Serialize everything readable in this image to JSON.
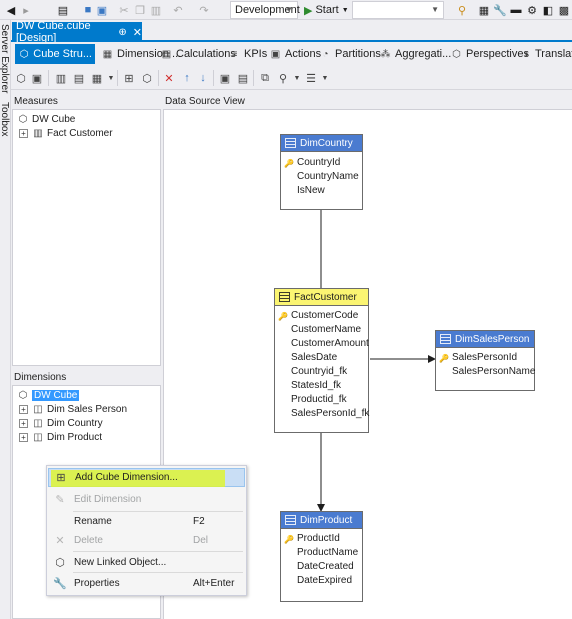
{
  "main_toolbar": {
    "solution_config": "Development",
    "start_label": "Start"
  },
  "side_strip": {
    "server_explorer": "Server Explorer",
    "toolbox": "Toolbox"
  },
  "document_tab": {
    "title": "DW Cube.cube [Design]",
    "pin": "⊕",
    "close": "✕"
  },
  "designer_tabs": [
    {
      "label": "Cube Stru...",
      "icon": "cube-icon"
    },
    {
      "label": "Dimension ...",
      "icon": "dimension-usage-icon"
    },
    {
      "label": "Calculations",
      "icon": "calculations-icon"
    },
    {
      "label": "KPIs",
      "icon": "kpi-icon"
    },
    {
      "label": "Actions",
      "icon": "actions-icon"
    },
    {
      "label": "Partitions",
      "icon": "partitions-icon"
    },
    {
      "label": "Aggregati...",
      "icon": "aggregations-icon"
    },
    {
      "label": "Perspectives",
      "icon": "perspectives-icon"
    },
    {
      "label": "Translatio",
      "icon": "translations-icon"
    }
  ],
  "measures_pane": {
    "header": "Measures",
    "root": "DW Cube",
    "items": [
      "Fact Customer"
    ]
  },
  "dimensions_pane": {
    "header": "Dimensions",
    "root": "DW Cube",
    "items": [
      "Dim Sales Person",
      "Dim Country",
      "Dim Product"
    ]
  },
  "diagram": {
    "header": "Data Source View",
    "tables": {
      "dimcountry": {
        "name": "DimCountry",
        "columns": [
          "CountryId",
          "CountryName",
          "IsNew"
        ],
        "key_index": 0
      },
      "factcustomer": {
        "name": "FactCustomer",
        "columns": [
          "CustomerCode",
          "CustomerName",
          "CustomerAmount",
          "SalesDate",
          "Countryid_fk",
          "StatesId_fk",
          "Productid_fk",
          "SalesPersonId_fk"
        ],
        "key_index": 0
      },
      "dimsalesperson": {
        "name": "DimSalesPerson",
        "columns": [
          "SalesPersonId",
          "SalesPersonName"
        ],
        "key_index": 0
      },
      "dimproduct": {
        "name": "DimProduct",
        "columns": [
          "ProductId",
          "ProductName",
          "DateCreated",
          "DateExpired"
        ],
        "key_index": 0
      }
    }
  },
  "context_menu": {
    "items": [
      {
        "label": "Add Cube Dimension...",
        "shortcut": "",
        "enabled": true,
        "icon": "add-dimension-icon"
      },
      {
        "label": "Edit Dimension",
        "shortcut": "",
        "enabled": false,
        "icon": "edit-dimension-icon"
      },
      {
        "label": "Rename",
        "shortcut": "F2",
        "enabled": true,
        "icon": ""
      },
      {
        "label": "Delete",
        "shortcut": "Del",
        "enabled": false,
        "icon": "delete-icon"
      },
      {
        "label": "New Linked Object...",
        "shortcut": "",
        "enabled": true,
        "icon": "linked-object-icon"
      },
      {
        "label": "Properties",
        "shortcut": "Alt+Enter",
        "enabled": true,
        "icon": "wrench-icon"
      }
    ]
  },
  "colors": {
    "accent": "#007acc",
    "table_header_blue": "#4a7bd0",
    "fact_header_yellow": "#fbf572",
    "highlighter": "#def534"
  }
}
